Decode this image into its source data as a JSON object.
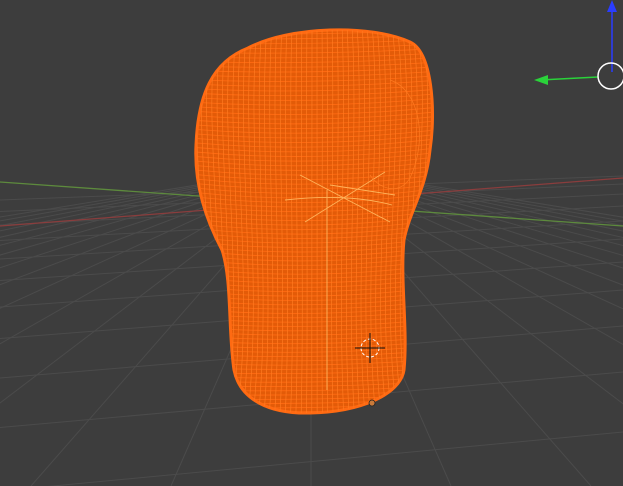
{
  "scene": {
    "mode": "wireframe-edit",
    "selected_object": "wireframe-mesh",
    "colors": {
      "background": "#3d3d3d",
      "grid": "#4b4b4b",
      "x_axis": "#8a3d3d",
      "y_axis": "#5d8a3d",
      "wireframe": "#ff6a12",
      "gizmo_z": "#2a3dff",
      "gizmo_y": "#2ad23a"
    }
  },
  "gizmo": {
    "visible_axes": [
      "z",
      "y"
    ],
    "icons": [
      "z-axis-arrow-icon",
      "y-axis-arrow-icon",
      "view-orbit-circle-icon"
    ]
  },
  "cursor_3d": {
    "icon": "3d-cursor-icon"
  },
  "origin": {
    "icon": "object-origin-dot-icon"
  }
}
